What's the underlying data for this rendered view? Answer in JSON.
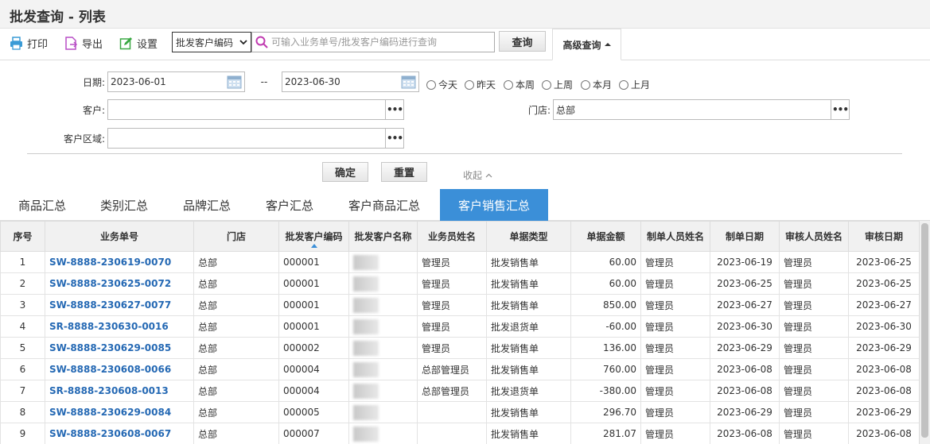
{
  "title": "批发查询 - 列表",
  "toolbar": {
    "print": "打印",
    "export": "导出",
    "settings": "设置",
    "search_field": "批发客户编码",
    "search_placeholder": "可输入业务单号/批发客户编码进行查询",
    "query": "查询",
    "advanced": "高级查询"
  },
  "filter": {
    "date_label": "日期:",
    "date_from": "2023-06-01",
    "date_sep": "--",
    "date_to": "2023-06-30",
    "quick": [
      "今天",
      "昨天",
      "本周",
      "上周",
      "本月",
      "上月"
    ],
    "customer_label": "客户:",
    "customer_value": "",
    "store_label": "门店:",
    "store_value": "总部",
    "region_label": "客户区域:",
    "region_value": "",
    "confirm": "确定",
    "reset": "重置",
    "collapse": "收起"
  },
  "tabs": [
    "商品汇总",
    "类别汇总",
    "品牌汇总",
    "客户汇总",
    "客户商品汇总",
    "客户销售汇总"
  ],
  "active_tab": "客户销售汇总",
  "table": {
    "columns": [
      "序号",
      "业务单号",
      "门店",
      "批发客户编码",
      "批发客户名称",
      "业务员姓名",
      "单据类型",
      "单据金额",
      "制单人员姓名",
      "制单日期",
      "审核人员姓名",
      "审核日期"
    ],
    "rows": [
      {
        "no": "1",
        "order": "SW-8888-230619-0070",
        "store": "总部",
        "code": "000001",
        "name": "",
        "sales": "管理员",
        "type": "批发销售单",
        "amount": "60.00",
        "maker": "管理员",
        "make_date": "2023-06-19",
        "auditor": "管理员",
        "audit_date": "2023-06-25"
      },
      {
        "no": "2",
        "order": "SW-8888-230625-0072",
        "store": "总部",
        "code": "000001",
        "name": "",
        "sales": "管理员",
        "type": "批发销售单",
        "amount": "60.00",
        "maker": "管理员",
        "make_date": "2023-06-25",
        "auditor": "管理员",
        "audit_date": "2023-06-25"
      },
      {
        "no": "3",
        "order": "SW-8888-230627-0077",
        "store": "总部",
        "code": "000001",
        "name": "",
        "sales": "管理员",
        "type": "批发销售单",
        "amount": "850.00",
        "maker": "管理员",
        "make_date": "2023-06-27",
        "auditor": "管理员",
        "audit_date": "2023-06-27"
      },
      {
        "no": "4",
        "order": "SR-8888-230630-0016",
        "store": "总部",
        "code": "000001",
        "name": "",
        "sales": "管理员",
        "type": "批发退货单",
        "amount": "-60.00",
        "maker": "管理员",
        "make_date": "2023-06-30",
        "auditor": "管理员",
        "audit_date": "2023-06-30"
      },
      {
        "no": "5",
        "order": "SW-8888-230629-0085",
        "store": "总部",
        "code": "000002",
        "name": "",
        "sales": "管理员",
        "type": "批发销售单",
        "amount": "136.00",
        "maker": "管理员",
        "make_date": "2023-06-29",
        "auditor": "管理员",
        "audit_date": "2023-06-29"
      },
      {
        "no": "6",
        "order": "SW-8888-230608-0066",
        "store": "总部",
        "code": "000004",
        "name": "",
        "sales": "总部管理员",
        "type": "批发销售单",
        "amount": "760.00",
        "maker": "管理员",
        "make_date": "2023-06-08",
        "auditor": "管理员",
        "audit_date": "2023-06-08"
      },
      {
        "no": "7",
        "order": "SR-8888-230608-0013",
        "store": "总部",
        "code": "000004",
        "name": "",
        "sales": "总部管理员",
        "type": "批发退货单",
        "amount": "-380.00",
        "maker": "管理员",
        "make_date": "2023-06-08",
        "auditor": "管理员",
        "audit_date": "2023-06-08"
      },
      {
        "no": "8",
        "order": "SW-8888-230629-0084",
        "store": "总部",
        "code": "000005",
        "name": "",
        "sales": "",
        "type": "批发销售单",
        "amount": "296.70",
        "maker": "管理员",
        "make_date": "2023-06-29",
        "auditor": "管理员",
        "audit_date": "2023-06-29"
      },
      {
        "no": "9",
        "order": "SW-8888-230608-0067",
        "store": "总部",
        "code": "000007",
        "name": "",
        "sales": "",
        "type": "批发销售单",
        "amount": "281.07",
        "maker": "管理员",
        "make_date": "2023-06-08",
        "auditor": "管理员",
        "audit_date": "2023-06-08"
      }
    ]
  },
  "colors": {
    "accent": "#3b8fd8",
    "link": "#2569b4",
    "print_icon": "#3a9bd6",
    "export_icon": "#b84fc6",
    "settings_icon": "#3aa843",
    "search_icon": "#c03ab0"
  }
}
